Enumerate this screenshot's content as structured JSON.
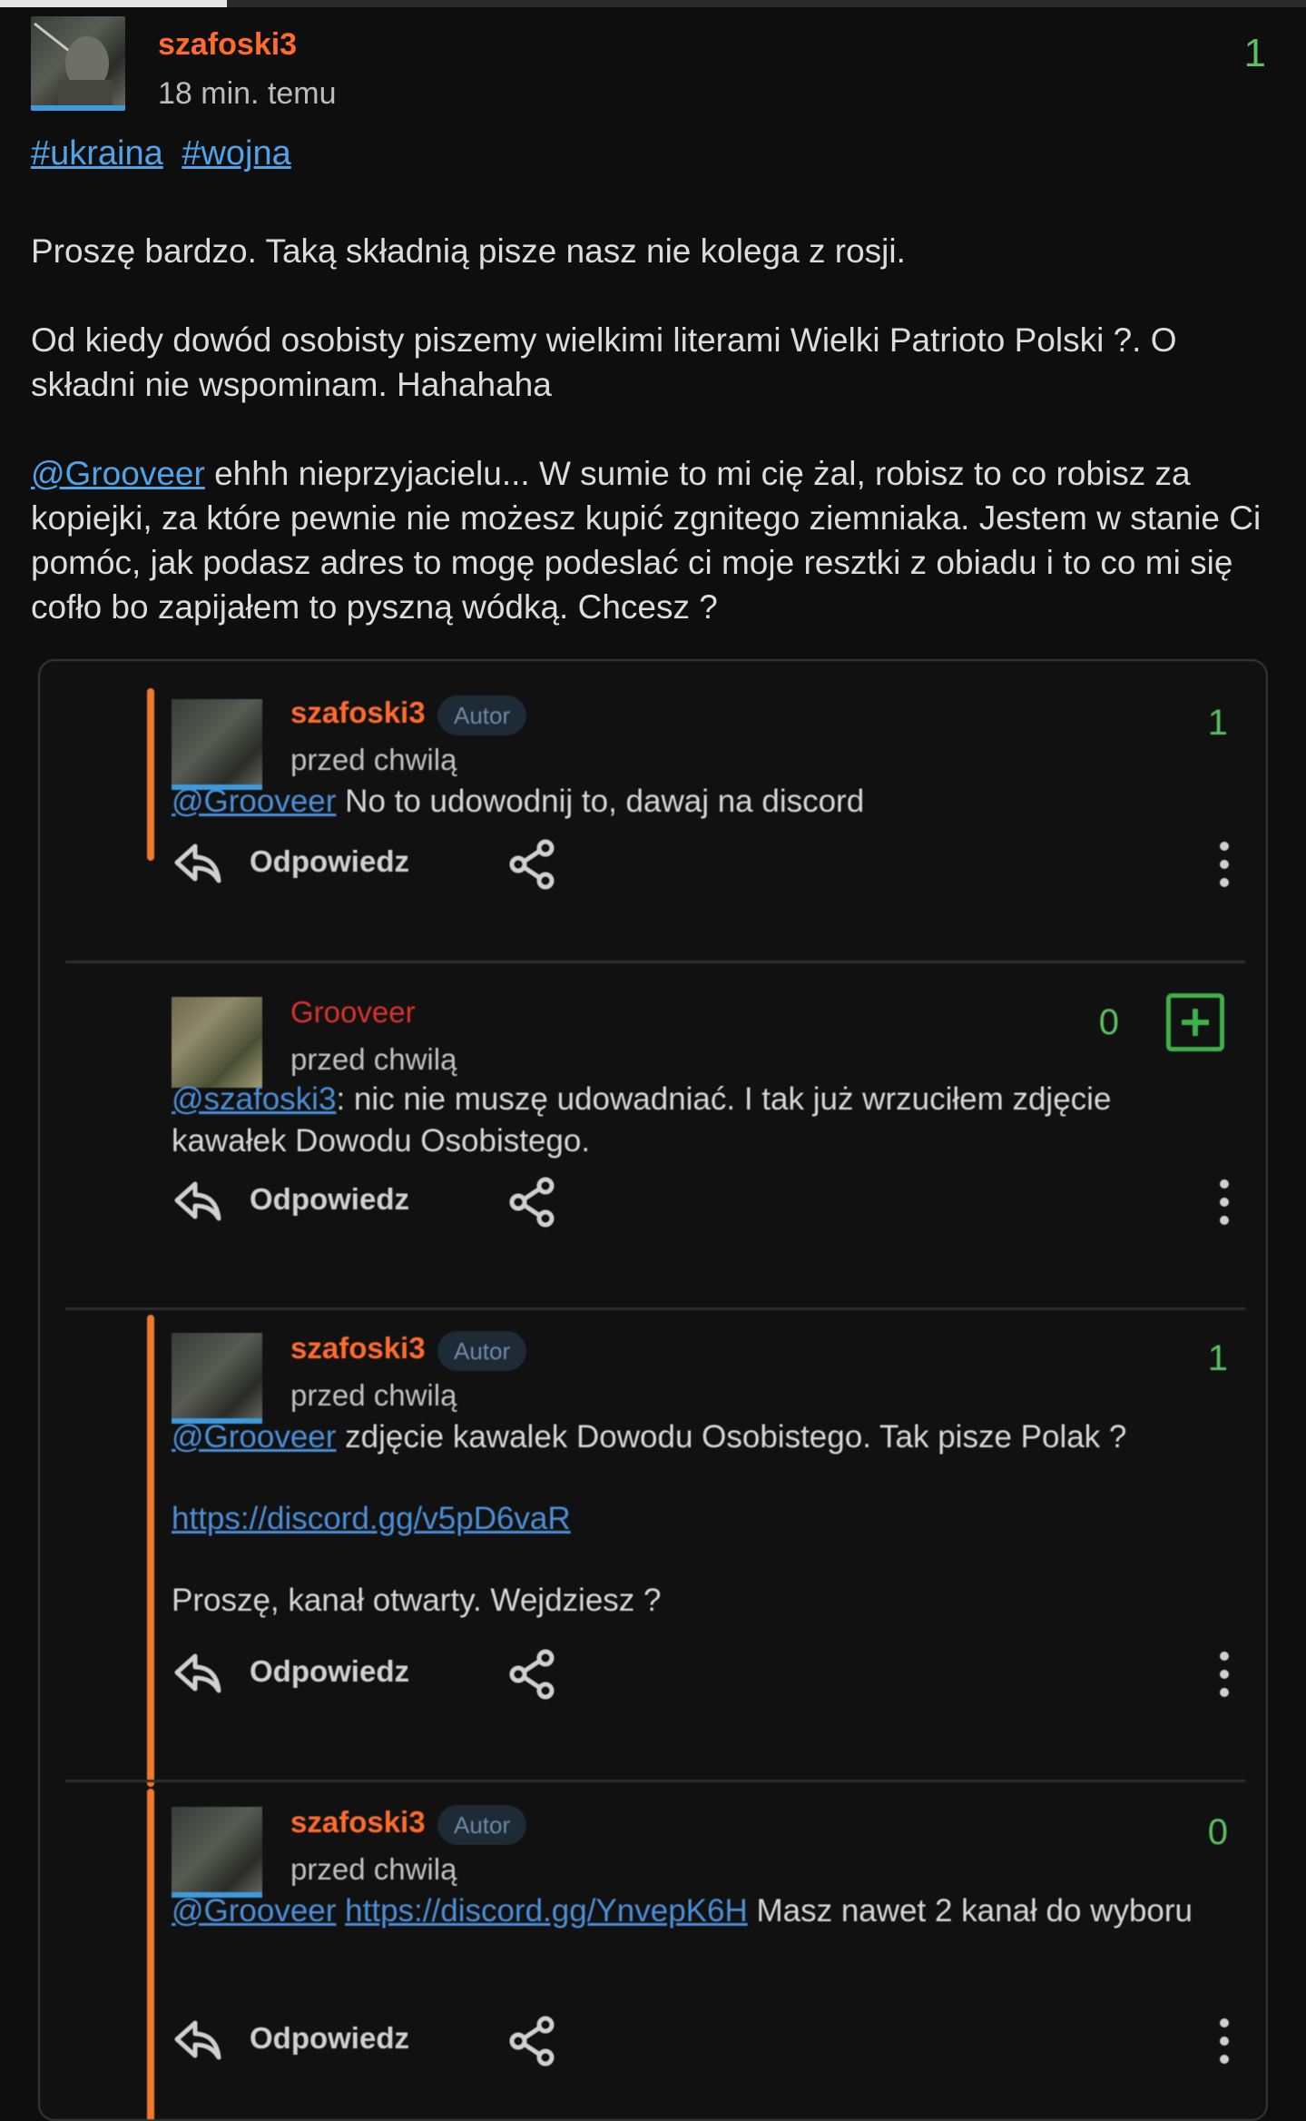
{
  "post": {
    "author": "szafoski3",
    "time": "18 min. temu",
    "score": "1",
    "tags": [
      "#ukraina",
      "#wojna"
    ],
    "paragraph1": "Proszę bardzo. Taką składnią pisze nasz nie kolega z rosji.",
    "paragraph2": "Od kiedy dowód osobisty piszemy wielkimi literami Wielki Patrioto Polski ?. O składni nie wspominam. Hahahaha",
    "mention": "@Grooveer",
    "paragraph3": " ehhh nieprzyjacielu... W sumie to mi cię żal, robisz to co robisz za kopiejki, za które pewnie nie możesz kupić zgnitego ziemniaka. Jestem w stanie Ci pomóc, jak podasz adres to mogę podeslać ci moje resztki z obiadu i to co mi się cofło bo zapijałem to pyszną wódką. Chcesz ?"
  },
  "embedded_comments": {
    "reply_label": "Odpowiedz",
    "c1": {
      "author": "szafoski3",
      "badge": "Autor",
      "time": "przed chwilą",
      "score": "1",
      "mention": "@Grooveer",
      "text": " No to udowodnij to, dawaj na discord"
    },
    "c2": {
      "author": "Grooveer",
      "time": "przed chwilą",
      "score": "0",
      "mention": "@szafoski3",
      "text": ": nic nie muszę udowadniać. I tak już wrzuciłem zdjęcie kawałek Dowodu Osobistego."
    },
    "c3": {
      "author": "szafoski3",
      "badge": "Autor",
      "time": "przed chwilą",
      "score": "1",
      "mention": "@Grooveer",
      "text": " zdjęcie kawalek Dowodu Osobistego. Tak pisze Polak ?",
      "link": "https://discord.gg/v5pD6vaR",
      "text2": "Proszę, kanał otwarty. Wejdziesz ?"
    },
    "c4": {
      "author": "szafoski3",
      "badge": "Autor",
      "time": "przed chwilą",
      "score": "0",
      "mention": "@Grooveer",
      "link": "https://discord.gg/YnvepK6H",
      "text": " Masz nawet 2 kanał do wyboru"
    }
  }
}
